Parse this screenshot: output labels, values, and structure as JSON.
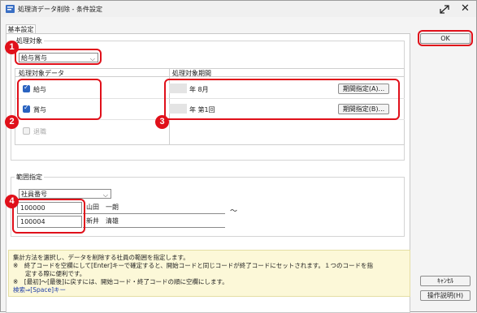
{
  "window": {
    "title": "処理済データ削除 - 条件設定"
  },
  "tabs": [
    {
      "label": "基本設定"
    }
  ],
  "target": {
    "legend": "処理対象",
    "select_value": "給与賞与"
  },
  "grid": {
    "headers": {
      "data": "処理対象データ",
      "period": "処理対象期間"
    },
    "rows": [
      {
        "label": "給与",
        "checked": true,
        "period_text": "年 8月",
        "button": "期間指定(A)..."
      },
      {
        "label": "賞与",
        "checked": true,
        "period_text": "年 第1回",
        "button": "期間指定(B)..."
      },
      {
        "label": "退職",
        "checked": false
      }
    ]
  },
  "range": {
    "legend": "範囲指定",
    "select_value": "社員番号",
    "from": {
      "code": "100000",
      "name": "山田　一朗"
    },
    "to": {
      "code": "100004",
      "name": "新井　清雄"
    },
    "tilde": "～"
  },
  "help": {
    "lines": [
      "集計方法を選択し、データを削除する社員の範囲を指定します。",
      "※　終了コードを空欄にして[Enter]キーで確定すると、開始コードと同じコードが終了コードにセットされます。１つのコードを指",
      "　　定する際に便利です。",
      "※　[最初]～[最後]に戻すには、開始コード・終了コードの順に空欄にします。",
      "検索⇒[Space]キー"
    ]
  },
  "buttons": {
    "ok": "OK",
    "cancel": "ｷｬﾝｾﾙ",
    "help": "操作説明(H)"
  },
  "annotations": [
    "1",
    "2",
    "3",
    "4"
  ],
  "colors": {
    "annotation": "#e0101a",
    "checkbox": "#2a63c0",
    "help_bg": "#fcf8d8"
  }
}
